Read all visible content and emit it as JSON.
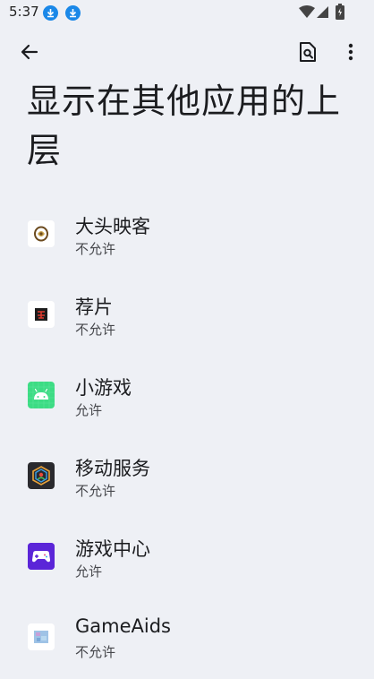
{
  "status_bar": {
    "time": "5:37",
    "icons": [
      "download-icon",
      "download-icon",
      "wifi-icon",
      "cellular-signal-icon",
      "battery-icon"
    ]
  },
  "app_bar": {
    "back_icon": "arrow-back-icon",
    "search_icon": "search-document-icon",
    "more_icon": "more-vert-icon"
  },
  "page": {
    "title": "显示在其他应用的上层"
  },
  "apps": [
    {
      "name": "大头映客",
      "status": "不允许",
      "icon": "yingke-app-icon"
    },
    {
      "name": "荐片",
      "status": "不允许",
      "icon": "jianpian-app-icon"
    },
    {
      "name": "小游戏",
      "status": "允许",
      "icon": "android-app-icon"
    },
    {
      "name": "移动服务",
      "status": "不允许",
      "icon": "mobile-services-app-icon"
    },
    {
      "name": "游戏中心",
      "status": "允许",
      "icon": "game-center-app-icon"
    },
    {
      "name": "GameAids",
      "status": "不允许",
      "icon": "gameaids-app-icon"
    }
  ],
  "colors": {
    "background": "#eef0f5",
    "text_primary": "#1b1c1f",
    "text_secondary": "#46474c",
    "download_badge": "#1a88e8"
  }
}
